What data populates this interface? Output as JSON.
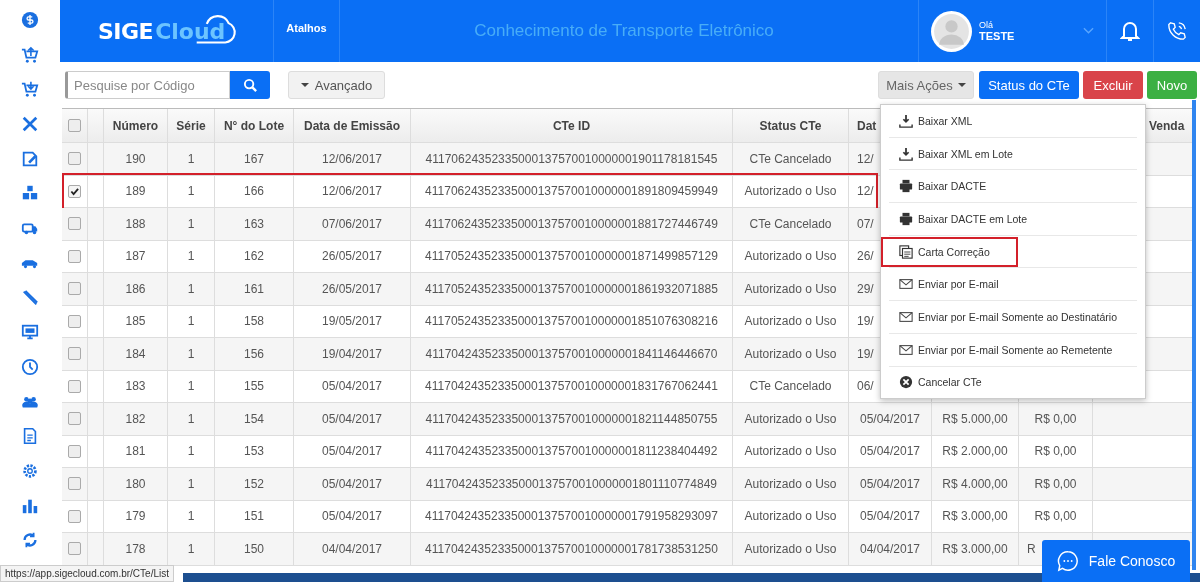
{
  "header": {
    "logo": {
      "strong": "SIGE",
      "light": "Cloud"
    },
    "shortcuts": "Atalhos",
    "title": "Conhecimento de Transporte Eletrônico",
    "user": {
      "greeting": "Olá",
      "name": "TESTE"
    }
  },
  "toolbar": {
    "search": {
      "placeholder": "Pesquise por Código"
    },
    "advanced": "Avançado",
    "more_actions": {
      "label": "Mais Ações",
      "expanded": true
    },
    "status_button": "Status do CTe",
    "delete_button": "Excluir",
    "new_button": "Novo"
  },
  "menu": [
    {
      "kind": "download",
      "label": "Baixar XML",
      "highlighted": false
    },
    {
      "kind": "download",
      "label": "Baixar XML em Lote",
      "highlighted": false
    },
    {
      "kind": "print",
      "label": "Baixar DACTE",
      "highlighted": false
    },
    {
      "kind": "print",
      "label": "Baixar DACTE em Lote",
      "highlighted": false
    },
    {
      "kind": "copy",
      "label": "Carta Correção",
      "highlighted": true
    },
    {
      "kind": "mail",
      "label": "Enviar por E-mail",
      "highlighted": false
    },
    {
      "kind": "mail",
      "label": "Enviar por E-mail Somente ao Destinatário",
      "highlighted": false
    },
    {
      "kind": "mail",
      "label": "Enviar por E-mail Somente ao Remetente",
      "highlighted": false
    },
    {
      "kind": "cancel",
      "label": "Cancelar CTe",
      "highlighted": false
    }
  ],
  "table": {
    "header_checked": false,
    "columns": [
      "Número",
      "Série",
      "N° do Lote",
      "Data de Emissão",
      "CTe ID",
      "Status CTe",
      "Dat",
      "Venda"
    ],
    "rows": [
      {
        "checked": false,
        "highlighted": false,
        "cells": [
          "190",
          "1",
          "167",
          "12/06/2017",
          "41170624352335000137570010000001901178181545",
          "CTe Cancelado"
        ],
        "cut": "12/"
      },
      {
        "checked": true,
        "highlighted": true,
        "cells": [
          "189",
          "1",
          "166",
          "12/06/2017",
          "41170624352335000137570010000001891809459949",
          "Autorizado o Uso"
        ],
        "cut": "12/"
      },
      {
        "checked": false,
        "highlighted": false,
        "cells": [
          "188",
          "1",
          "163",
          "07/06/2017",
          "41170624352335000137570010000001881727446749",
          "CTe Cancelado"
        ],
        "cut": "07/"
      },
      {
        "checked": false,
        "highlighted": false,
        "cells": [
          "187",
          "1",
          "162",
          "26/05/2017",
          "41170524352335000137570010000001871499857129",
          "Autorizado o Uso"
        ],
        "cut": "26/"
      },
      {
        "checked": false,
        "highlighted": false,
        "cells": [
          "186",
          "1",
          "161",
          "26/05/2017",
          "41170524352335000137570010000001861932071885",
          "Autorizado o Uso"
        ],
        "cut": "29/"
      },
      {
        "checked": false,
        "highlighted": false,
        "cells": [
          "185",
          "1",
          "158",
          "19/05/2017",
          "41170524352335000137570010000001851076308216",
          "Autorizado o Uso"
        ],
        "cut": "19/"
      },
      {
        "checked": false,
        "highlighted": false,
        "cells": [
          "184",
          "1",
          "156",
          "19/04/2017",
          "41170424352335000137570010000001841146446670",
          "Autorizado o Uso"
        ],
        "cut": "19/"
      },
      {
        "checked": false,
        "highlighted": false,
        "cells": [
          "183",
          "1",
          "155",
          "05/04/2017",
          "41170424352335000137570010000001831767062441",
          "CTe Cancelado"
        ],
        "cut": "06/"
      },
      {
        "checked": false,
        "highlighted": false,
        "cells": [
          "182",
          "1",
          "154",
          "05/04/2017",
          "41170424352335000137570010000001821144850755",
          "Autorizado o Uso",
          "05/04/2017",
          "R$ 5.000,00",
          "R$ 0,00"
        ]
      },
      {
        "checked": false,
        "highlighted": false,
        "cells": [
          "181",
          "1",
          "153",
          "05/04/2017",
          "41170424352335000137570010000001811238404492",
          "Autorizado o Uso",
          "05/04/2017",
          "R$ 2.000,00",
          "R$ 0,00"
        ]
      },
      {
        "checked": false,
        "highlighted": false,
        "cells": [
          "180",
          "1",
          "152",
          "05/04/2017",
          "41170424352335000137570010000001801110774849",
          "Autorizado o Uso",
          "05/04/2017",
          "R$ 4.000,00",
          "R$ 0,00"
        ]
      },
      {
        "checked": false,
        "highlighted": false,
        "cells": [
          "179",
          "1",
          "151",
          "05/04/2017",
          "41170424352335000137570010000001791958293097",
          "Autorizado o Uso",
          "05/04/2017",
          "R$ 3.000,00",
          "R$ 0,00"
        ]
      },
      {
        "checked": false,
        "highlighted": false,
        "cells": [
          "178",
          "1",
          "150",
          "04/04/2017",
          "41170424352335000137570010000001781738531250",
          "Autorizado o Uso",
          "04/04/2017",
          "R$ 3.000,00"
        ],
        "cut": "R"
      }
    ]
  },
  "chat_button": "Fale Conosco",
  "status_url": "https://app.sigecloud.com.br/CTe/List"
}
